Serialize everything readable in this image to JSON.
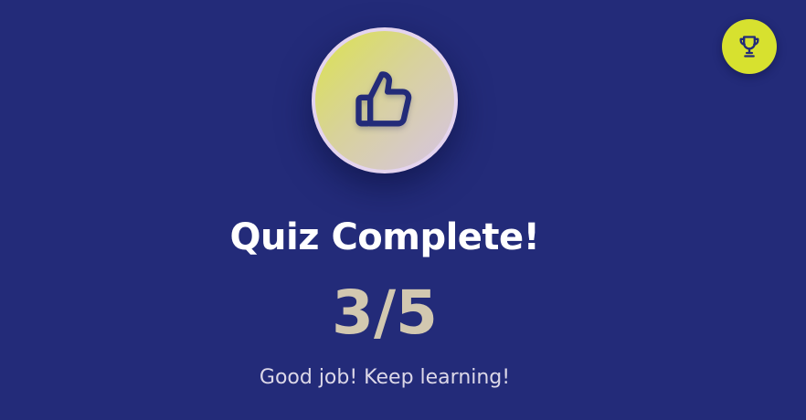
{
  "result": {
    "title": "Quiz Complete!",
    "score": "3/5",
    "score_value": 3,
    "score_total": 5,
    "message": "Good job! Keep learning!"
  },
  "icons": {
    "hero": "thumbs-up-icon",
    "corner_button": "trophy-icon"
  },
  "colors": {
    "background": "#232b79",
    "accent": "#d7e12f",
    "icon_stroke": "#232b79",
    "title": "#ffffff",
    "score": "#d2c8b0",
    "message": "#dcd8e8"
  }
}
